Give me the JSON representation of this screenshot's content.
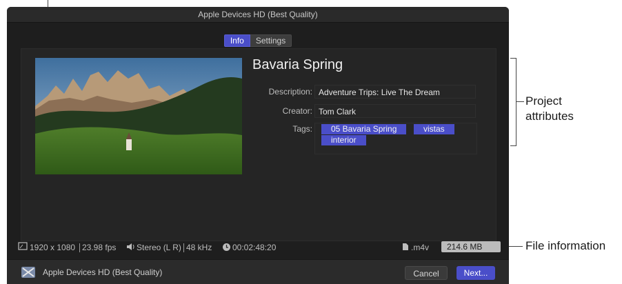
{
  "window": {
    "title": "Apple Devices HD (Best Quality)"
  },
  "tabs": [
    {
      "label": "Info",
      "active": true
    },
    {
      "label": "Settings",
      "active": false
    }
  ],
  "project": {
    "title": "Bavaria Spring",
    "fields": [
      {
        "label": "Description:",
        "value": "Adventure Trips: Live The Dream"
      },
      {
        "label": "Creator:",
        "value": "Tom Clark"
      }
    ],
    "tags_label": "Tags:",
    "tags": [
      "05 Bavaria Spring",
      "vistas",
      "interior"
    ]
  },
  "file_info": {
    "resolution": "1920 x 1080",
    "fps": "23.98 fps",
    "audio": "Stereo (L R)",
    "sample_rate": "48 kHz",
    "duration": "00:02:48:20",
    "extension": ".m4v",
    "size": "214.6 MB est."
  },
  "footer": {
    "preset": "Apple Devices HD (Best Quality)",
    "cancel": "Cancel",
    "next": "Next..."
  },
  "callouts": {
    "project_attributes": "Project attributes",
    "file_information": "File information"
  },
  "icons": {
    "resolution": "frame-icon",
    "audio": "speaker-icon",
    "duration": "clock-icon",
    "file": "document-icon",
    "preset": "apple-devices-icon"
  },
  "colors": {
    "accent": "#4a4ec9",
    "window_bg": "#1e1e1e"
  }
}
